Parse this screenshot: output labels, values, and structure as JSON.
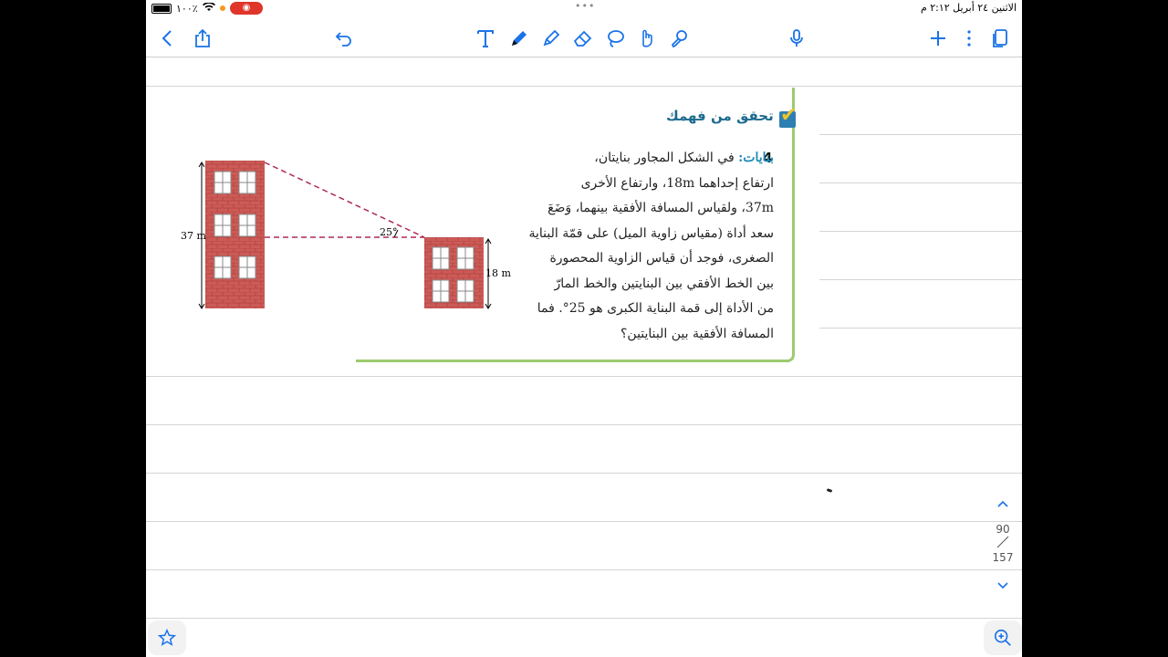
{
  "status_bar": {
    "battery": "١٠٠٪",
    "record_icon": "record-icon",
    "datetime": "الاثنين ٢٤ أبريل ٢:١٢ م"
  },
  "toolbar": {
    "icons": [
      "back-chevron",
      "share",
      "undo",
      "text-tool",
      "pen-tool",
      "highlighter-tool",
      "eraser-tool",
      "lasso-tool",
      "shapes-tool",
      "touch-tool",
      "microphone",
      "add",
      "more",
      "pages"
    ]
  },
  "content": {
    "section_title": "تحقق من فهمك",
    "question_number": "4",
    "question_title": "بنايات:",
    "question_lines": [
      "في الشكل المجاور بنايتان،",
      "ارتفاع إحداهما 18m، وارتفاع الأخرى",
      "37m، ولقياس المسافة الأفقية بينهما، وَضَعَ",
      "سعد أداة (مقياس زاوية الميل) على قمّة البناية",
      "الصغرى، فوجد أن قياس الزاوية المحصورة",
      "بين الخط الأفقي بين البنايتين والخط المارّ",
      "من الأداة إلى قمة البناية الكبرى هو 25°. فما",
      "المسافة الأفقية بين البنايتين؟"
    ],
    "figure": {
      "tall_label": "37 m",
      "short_label": "18 m",
      "angle_label": "25°"
    }
  },
  "pager": {
    "current": "90",
    "total": "157"
  }
}
